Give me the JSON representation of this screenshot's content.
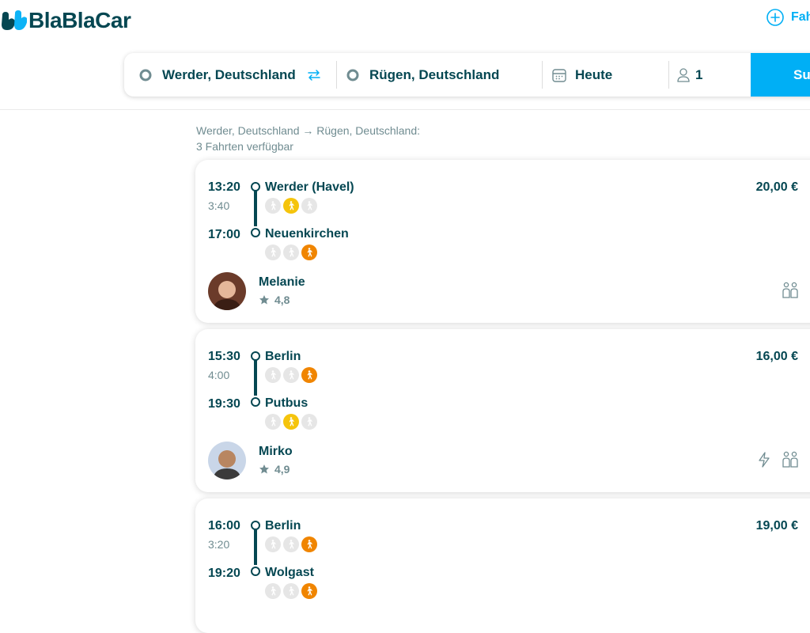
{
  "header": {
    "logo_text": "BlaBlaCar",
    "offer_label": "Fah"
  },
  "search": {
    "from": "Werder, Deutschland",
    "to": "Rügen, Deutschland",
    "date": "Heute",
    "passengers": "1",
    "button_label": "Su"
  },
  "summary": {
    "route": "Werder, Deutschland → Rügen, Deutschland:",
    "count": "3 Fahrten verfügbar"
  },
  "colors": {
    "brand": "#054752",
    "accent": "#00aff5",
    "walk_near": "#f5c40c",
    "walk_far": "#f08500",
    "walk_none": "#e6e6e6"
  },
  "rides": [
    {
      "depart_time": "13:20",
      "duration": "3:40",
      "arrive_time": "17:00",
      "from": "Werder (Havel)",
      "to": "Neuenkirchen",
      "price": "20,00 €",
      "from_proximity": [
        "grey",
        "yellow",
        "grey"
      ],
      "to_proximity": [
        "grey",
        "grey",
        "orange"
      ],
      "driver": "Melanie",
      "rating": "4,8",
      "instant_booking": false,
      "max_two_back": true
    },
    {
      "depart_time": "15:30",
      "duration": "4:00",
      "arrive_time": "19:30",
      "from": "Berlin",
      "to": "Putbus",
      "price": "16,00 €",
      "from_proximity": [
        "grey",
        "grey",
        "orange"
      ],
      "to_proximity": [
        "grey",
        "yellow",
        "grey"
      ],
      "driver": "Mirko",
      "rating": "4,9",
      "instant_booking": true,
      "max_two_back": true
    },
    {
      "depart_time": "16:00",
      "duration": "3:20",
      "arrive_time": "19:20",
      "from": "Berlin",
      "to": "Wolgast",
      "price": "19,00 €",
      "from_proximity": [
        "grey",
        "grey",
        "orange"
      ],
      "to_proximity": [
        "grey",
        "grey",
        "orange"
      ]
    }
  ]
}
